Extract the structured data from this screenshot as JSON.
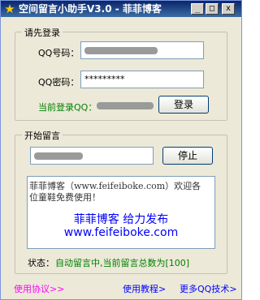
{
  "window": {
    "title": "空间留言小助手V3.0 - 菲菲博客",
    "minimize": "_",
    "maximize": "□",
    "close": "x"
  },
  "login_group": {
    "title": "请先登录",
    "qq_number_label": "QQ号码：",
    "qq_password_label": "QQ密码：",
    "qq_password_value": "*********",
    "current_login_label": "当前登录QQ：",
    "login_button": "登录"
  },
  "message_group": {
    "title": "开始留言",
    "stop_button": "停止",
    "message_text_line1": "菲菲博客（www.feifeiboke.com）欢迎各",
    "message_text_line2": "位童鞋免费使用！",
    "publisher_line1": "菲菲博客 给力发布",
    "publisher_line2": "www.feifeiboke.com",
    "status_label": "状态：",
    "status_value": "自动留言中,当前留言总数为[100]"
  },
  "footer": {
    "agreement_link": "使用协议>>",
    "tutorial_link": "使用教程>",
    "more_tech_link": "更多QQ技术>"
  },
  "colors": {
    "green_text": "#008000",
    "blue_text": "#0000ff",
    "magenta_link": "#ff00ff",
    "link_blue": "#0000ff"
  }
}
